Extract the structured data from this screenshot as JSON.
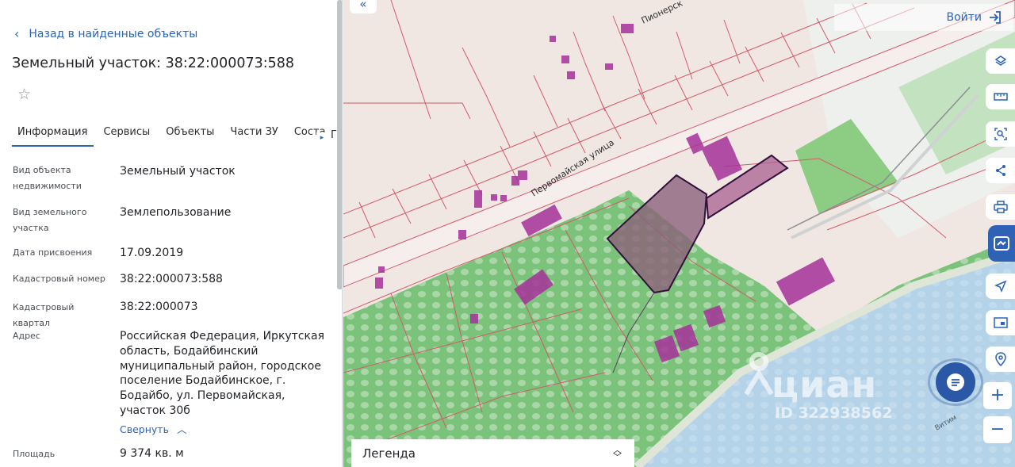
{
  "panel": {
    "back_label": "Назад в найденные объекты",
    "title": "Земельный участок: 38:22:000073:588",
    "tabs": [
      {
        "label": "Информация",
        "active": true
      },
      {
        "label": "Сервисы",
        "active": false
      },
      {
        "label": "Объекты",
        "active": false
      },
      {
        "label": "Части ЗУ",
        "active": false
      },
      {
        "label": "Соста",
        "active": false
      }
    ],
    "tabs_clipped": "Г",
    "rows": [
      {
        "label": "Вид объекта недвижимости",
        "value": "Земельный участок"
      },
      {
        "label": "Вид земельного участка",
        "value": "Землепользование"
      },
      {
        "label": "Дата присвоения",
        "value": "17.09.2019"
      },
      {
        "label": "Кадастровый номер",
        "value": "38:22:000073:588"
      },
      {
        "label": "Кадастровый квартал",
        "value": "38:22:000073"
      },
      {
        "label": "Адрес",
        "value": "Российская Федерация, Иркутская область, Бодайбинский муниципальный район, городское поселение Бодайбинское, г. Бодайбо, ул. Первомайская, участок 30б"
      },
      {
        "label": "Площадь уточненная",
        "value": "9 374 кв. м"
      }
    ],
    "collapse_label": "Свернуть"
  },
  "map": {
    "login_label": "Войти",
    "legend_label": "Легенда",
    "street_labels": [
      "Первомайская улица",
      "Пионерск",
      "Витим"
    ],
    "watermark_brand": "циан",
    "watermark_id": "ID 322938562",
    "tools": [
      "layers-icon",
      "ruler-icon",
      "area-select-icon",
      "share-icon",
      "print-icon",
      "active-tool-icon",
      "navigate-icon",
      "screen-icon",
      "location-icon"
    ],
    "zoom_in": "+",
    "zoom_out": "−"
  },
  "colors": {
    "accent": "#2b64b8",
    "parcel_fill": "#8a5f7a",
    "building": "#a6329a",
    "land": "#f1e7e2",
    "green": "#7bc27a",
    "river": "#b5d3e8",
    "boundary": "#d45a6a"
  }
}
